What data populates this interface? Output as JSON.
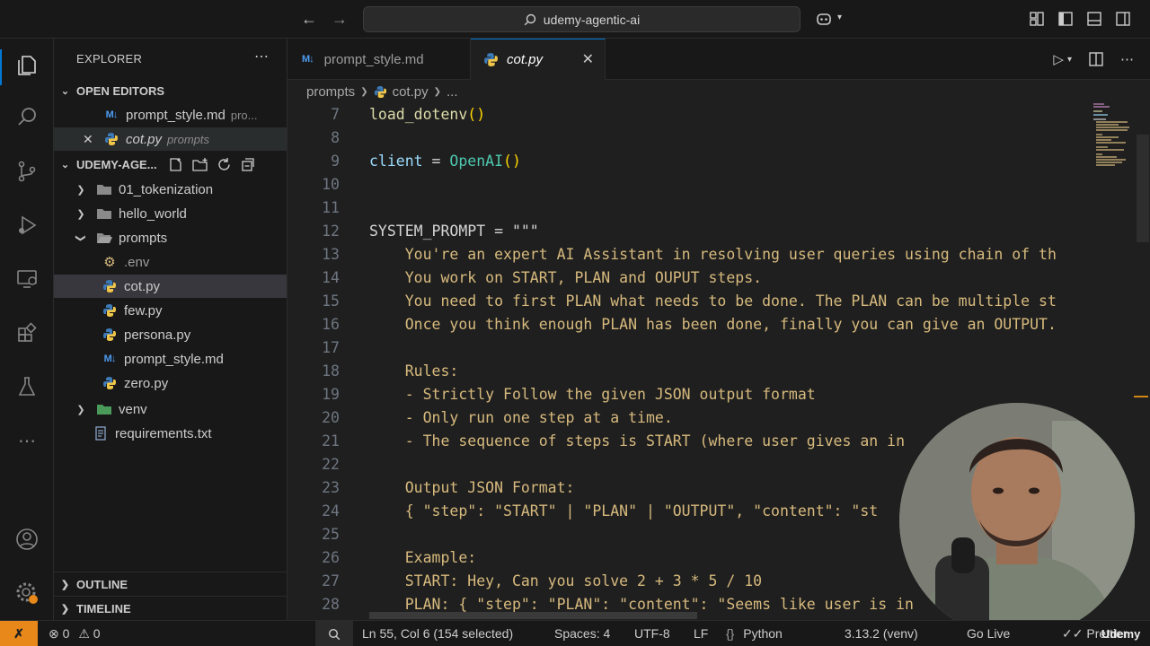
{
  "titlebar": {
    "search_label": "udemy-agentic-ai"
  },
  "sidebar": {
    "title": "EXPLORER",
    "open_editors_label": "OPEN EDITORS",
    "open_editors": [
      {
        "name": "prompt_style.md",
        "desc": "pro..."
      },
      {
        "name": "cot.py",
        "desc": "prompts"
      }
    ],
    "folder_label": "UDEMY-AGE...",
    "tree": [
      {
        "name": "01_tokenization"
      },
      {
        "name": "hello_world"
      },
      {
        "name": "prompts"
      },
      {
        "name": ".env"
      },
      {
        "name": "cot.py"
      },
      {
        "name": "few.py"
      },
      {
        "name": "persona.py"
      },
      {
        "name": "prompt_style.md"
      },
      {
        "name": "zero.py"
      },
      {
        "name": "venv"
      },
      {
        "name": "requirements.txt"
      }
    ],
    "outline_label": "OUTLINE",
    "timeline_label": "TIMELINE"
  },
  "tabs": [
    {
      "label": "prompt_style.md"
    },
    {
      "label": "cot.py"
    }
  ],
  "breadcrumb": {
    "folder": "prompts",
    "file": "cot.py",
    "rest": "..."
  },
  "code": {
    "numbers": [
      "7",
      "8",
      "9",
      "10",
      "11",
      "12",
      "13",
      "14",
      "15",
      "16",
      "17",
      "18",
      "19",
      "20",
      "21",
      "22",
      "23",
      "24",
      "25",
      "26",
      "27",
      "28"
    ],
    "line7_fn": "load_dotenv",
    "line9_var": "client",
    "line9_eq": " = ",
    "line9_cls": "OpenAI",
    "line12_var": "SYSTEM_PROMPT",
    "line12_rest": " = \"\"\"",
    "lines": {
      "13": "    You're an expert AI Assistant in resolving user queries using chain of th",
      "14": "    You work on START, PLAN and OUPUT steps.",
      "15": "    You need to first PLAN what needs to be done. The PLAN can be multiple st",
      "16": "    Once you think enough PLAN has been done, finally you can give an OUTPUT.",
      "18": "    Rules:",
      "19": "    - Strictly Follow the given JSON output format",
      "20": "    - Only run one step at a time.",
      "21": "    - The sequence of steps is START (where user gives an in",
      "23": "    Output JSON Format:",
      "24": "    { \"step\": \"START\" | \"PLAN\" | \"OUTPUT\", \"content\": \"st",
      "26": "    Example:",
      "27": "    START: Hey, Can you solve 2 + 3 * 5 / 10",
      "28": "    PLAN: { \"step\": \"PLAN\": \"content\": \"Seems like user is in"
    }
  },
  "status": {
    "errors": "0",
    "warnings": "0",
    "position": "Ln 55, Col 6 (154 selected)",
    "spaces": "Spaces: 4",
    "encoding": "UTF-8",
    "eol": "LF",
    "language": "Python",
    "interpreter": "3.13.2 (venv)",
    "golive": "Go Live",
    "prettier": "Prettier",
    "watermark": "Udemy"
  },
  "colors": {
    "accent": "#0078d4",
    "remote": "#e8881a",
    "string": "#d7ba7d"
  }
}
